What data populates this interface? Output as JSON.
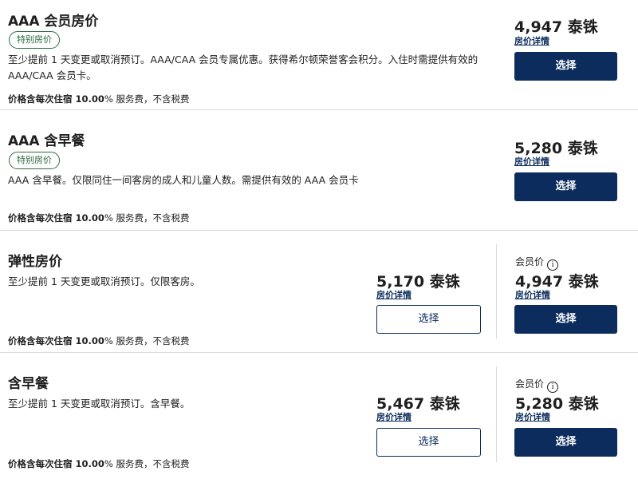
{
  "rates": [
    {
      "title": "AAA 会员房价",
      "badge": "特别房价",
      "description": "至少提前 1 天变更或取消预订。AAA/CAA 会员专属优惠。获得希尔顿荣誉客会积分。入住时需提供有效的 AAA/CAA 会员卡。",
      "fee_bold": "价格含每次住宿 10.00",
      "fee_rest": "% 服务费，不含税费",
      "price": "4,947 泰铢",
      "details_label": "房价详情",
      "select_label": "选择"
    },
    {
      "title": "AAA 含早餐",
      "badge": "特别房价",
      "description": "AAA 含早餐。仅限同住一间客房的成人和儿童人数。需提供有效的 AAA 会员卡",
      "fee_bold": "价格含每次住宿 10.00",
      "fee_rest": "% 服务费，不含税费",
      "price": "5,280 泰铢",
      "details_label": "房价详情",
      "select_label": "选择"
    },
    {
      "title": "弹性房价",
      "description": "至少提前 1 天变更或取消预订。仅限客房。",
      "fee_bold": "价格含每次住宿 10.00",
      "fee_rest": "% 服务费，不含税费",
      "price": "5,170 泰铢",
      "details_label": "房价详情",
      "select_label": "选择",
      "member": {
        "label": "会员价",
        "info_glyph": "i",
        "price": "4,947 泰铢",
        "details_label": "房价详情",
        "select_label": "选择"
      }
    },
    {
      "title": "含早餐",
      "description": "至少提前 1 天变更或取消预订。含早餐。",
      "fee_bold": "价格含每次住宿 10.00",
      "fee_rest": "% 服务费，不含税费",
      "price": "5,467 泰铢",
      "details_label": "房价详情",
      "select_label": "选择",
      "member": {
        "label": "会员价",
        "info_glyph": "i",
        "price": "5,280 泰铢",
        "details_label": "房价详情",
        "select_label": "选择"
      }
    }
  ],
  "colors": {
    "brand_navy": "#0b2c5c",
    "badge_green": "#2e6b3f",
    "divider": "#d9d9d9"
  }
}
